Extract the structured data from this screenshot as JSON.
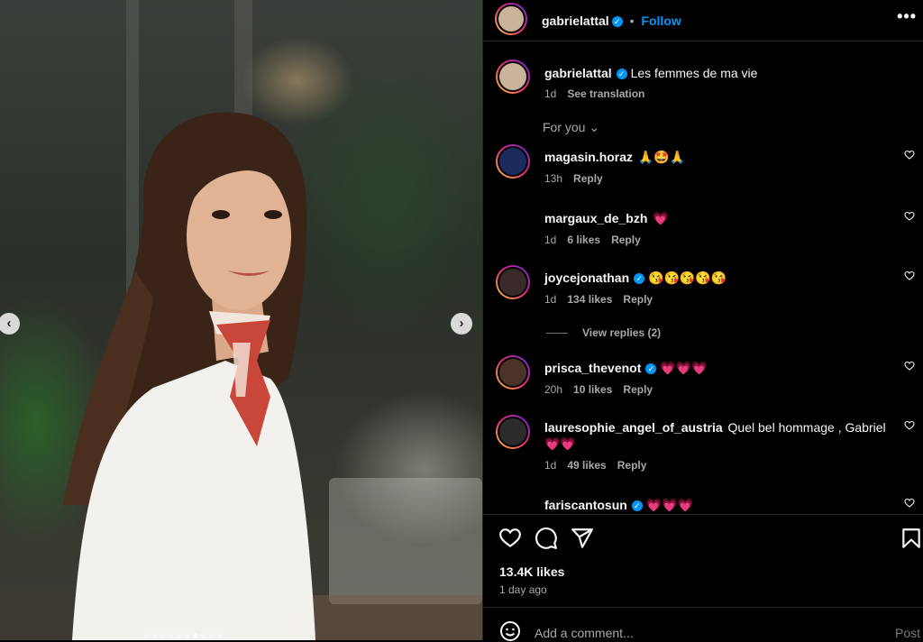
{
  "post": {
    "author": "gabrielattal",
    "follow_label": "Follow",
    "dot": "•",
    "more_label": "•••",
    "caption": "Les femmes de ma vie",
    "caption_time": "1d",
    "see_translation": "See translation",
    "for_you": "For you",
    "view_replies": "View replies (2)",
    "likes": "13.4K likes",
    "time_ago": "1 day ago",
    "comment_placeholder": "Add a comment...",
    "post_label": "Post",
    "carousel_count": 10,
    "carousel_active": 7
  },
  "comments": [
    {
      "user": "magasin.horaz",
      "verified": false,
      "text": "🙏🤩🙏",
      "time": "13h",
      "likes": "",
      "reply": "Reply"
    },
    {
      "user": "margaux_de_bzh",
      "verified": false,
      "text": "💗",
      "time": "1d",
      "likes": "6 likes",
      "reply": "Reply"
    },
    {
      "user": "joycejonathan",
      "verified": true,
      "text": "😘😘😘😘😘",
      "time": "1d",
      "likes": "134 likes",
      "reply": "Reply"
    },
    {
      "user": "prisca_thevenot",
      "verified": true,
      "text": "💗💗💗",
      "time": "20h",
      "likes": "10 likes",
      "reply": "Reply"
    },
    {
      "user": "lauresophie_angel_of_austria",
      "verified": false,
      "text": "Quel bel hommage , Gabriel 💗💗",
      "time": "1d",
      "likes": "49 likes",
      "reply": "Reply"
    },
    {
      "user": "fariscantosun",
      "verified": true,
      "text": "💗💗💗",
      "time": "",
      "likes": "",
      "reply": ""
    }
  ],
  "colors": {
    "accent": "#0095f6",
    "background": "#000000",
    "muted": "#a8a8a8"
  }
}
